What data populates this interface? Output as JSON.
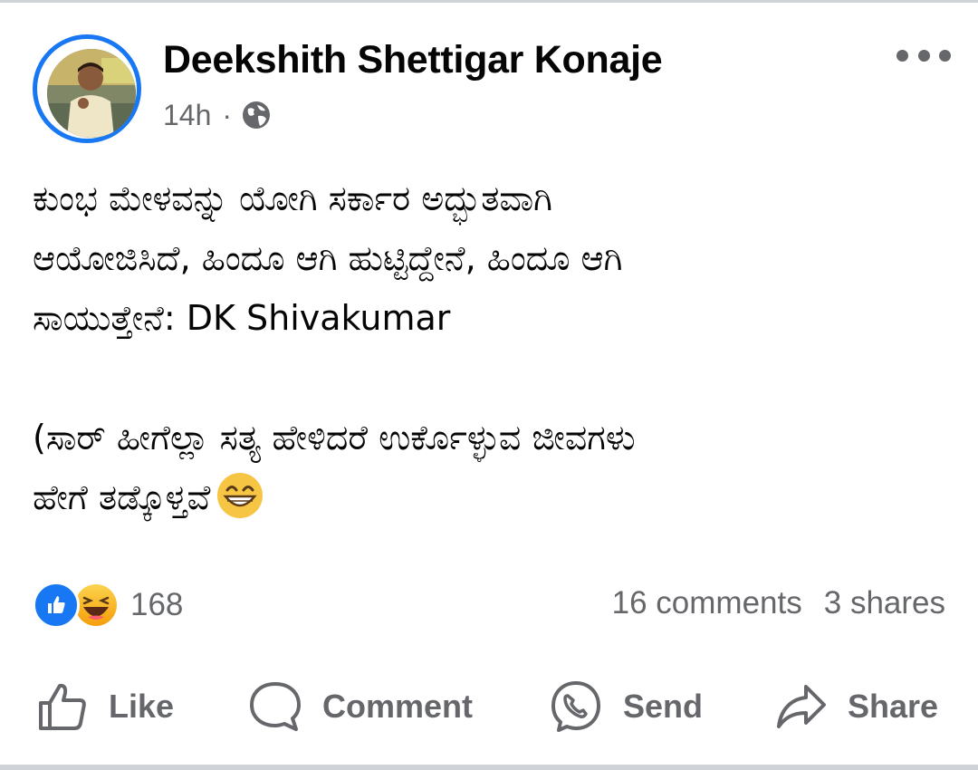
{
  "post": {
    "author": "Deekshith Shettigar Konaje",
    "time": "14h",
    "separator": "·",
    "privacy_icon": "globe-icon",
    "more_icon": "more-options-icon",
    "text_lines": [
      "ಕುಂಭ ಮೇಳವನ್ನು ಯೋಗಿ ಸರ್ಕಾರ ಅದ್ಭುತವಾಗಿ",
      "ಆಯೋಜಿಸಿದೆ, ಹಿಂದೂ ಆಗಿ ಹುಟ್ಟಿದ್ದೇನೆ, ಹಿಂದೂ ಆಗಿ",
      "ಸಾಯುತ್ತೇನೆ: DK Shivakumar",
      "(ಸಾರ್ ಹೀಗೆಲ್ಲಾ ಸತ್ಯ ಹೇಳಿದರೆ ಉರ್ಕೊಳ್ಳುವ ಜೀವಗಳು",
      "ಹೇಗೆ ತಡ್ಕೊಳ್ತವೆ"
    ],
    "emoji": "grinning-face-with-smiling-eyes-emoji"
  },
  "engagement": {
    "reaction_icons": [
      "like-reaction-icon",
      "haha-reaction-icon"
    ],
    "reaction_count": "168",
    "comments": "16 comments",
    "shares": "3 shares"
  },
  "actions": {
    "like": "Like",
    "comment": "Comment",
    "send": "Send",
    "share": "Share"
  },
  "colors": {
    "accent": "#1877f2",
    "secondary_text": "#65676b",
    "primary_text": "#050505",
    "haha_yellow": "#f7c544"
  }
}
